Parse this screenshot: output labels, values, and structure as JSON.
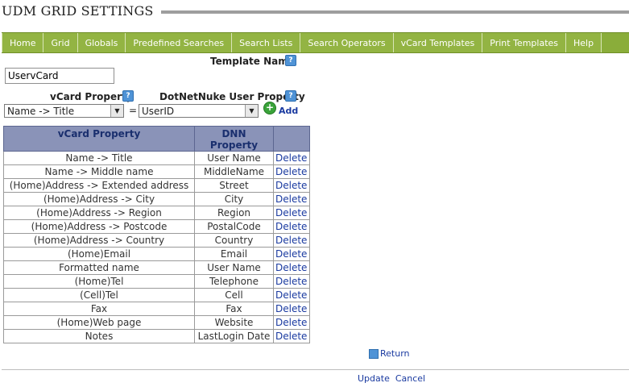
{
  "page": {
    "title": "UDM GRID SETTINGS"
  },
  "nav": {
    "items": [
      {
        "label": "Home"
      },
      {
        "label": "Grid"
      },
      {
        "label": "Globals"
      },
      {
        "label": "Predefined Searches"
      },
      {
        "label": "Search Lists"
      },
      {
        "label": "Search Operators"
      },
      {
        "label": "vCard Templates"
      },
      {
        "label": "Print Templates"
      },
      {
        "label": "Help"
      }
    ]
  },
  "form": {
    "template_name_label": "Template Name",
    "template_name_value": "UservCard",
    "vcard_property_label": "vCard Property",
    "dnn_property_label": "DotNetNuke User Property",
    "vcard_select_value": "Name -> Title",
    "equals": "=",
    "dnn_select_value": "UserID",
    "add_label": "Add"
  },
  "table": {
    "headers": [
      "vCard Property",
      "DNN Property"
    ],
    "delete_label": "Delete",
    "rows": [
      [
        "Name -> Title",
        "User Name"
      ],
      [
        "Name -> Middle name",
        "MiddleName"
      ],
      [
        "(Home)Address -> Extended address",
        "Street"
      ],
      [
        "(Home)Address -> City",
        "City"
      ],
      [
        "(Home)Address -> Region",
        "Region"
      ],
      [
        "(Home)Address -> Postcode",
        "PostalCode"
      ],
      [
        "(Home)Address -> Country",
        "Country"
      ],
      [
        "(Home)Email",
        "Email"
      ],
      [
        "Formatted name",
        "User Name"
      ],
      [
        "(Home)Tel",
        "Telephone"
      ],
      [
        "(Cell)Tel",
        "Cell"
      ],
      [
        "Fax",
        "Fax"
      ],
      [
        "(Home)Web page",
        "Website"
      ],
      [
        "Notes",
        "LastLogin Date"
      ]
    ]
  },
  "actions": {
    "return_label": "Return",
    "update_label": "Update",
    "cancel_label": "Cancel"
  }
}
